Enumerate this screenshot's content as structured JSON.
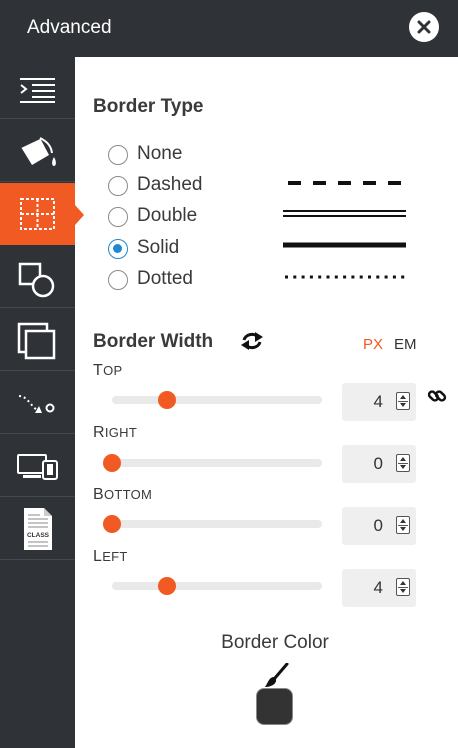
{
  "header": {
    "title": "Advanced"
  },
  "sidebar": {
    "items": [
      {
        "icon": "indent-icon"
      },
      {
        "icon": "paint-bucket-icon"
      },
      {
        "icon": "border-icon",
        "active": true
      },
      {
        "icon": "shapes-icon"
      },
      {
        "icon": "layers-icon"
      },
      {
        "icon": "motion-path-icon"
      },
      {
        "icon": "devices-icon"
      },
      {
        "icon": "class-file-icon",
        "label": "CLASS"
      }
    ]
  },
  "border_type": {
    "title": "Border Type",
    "options": [
      {
        "label": "None",
        "checked": false
      },
      {
        "label": "Dashed",
        "checked": false
      },
      {
        "label": "Double",
        "checked": false
      },
      {
        "label": "Solid",
        "checked": true
      },
      {
        "label": "Dotted",
        "checked": false
      }
    ]
  },
  "border_width": {
    "title": "Border Width",
    "units": [
      "PX",
      "EM"
    ],
    "active_unit": "PX",
    "sides": [
      {
        "label_first": "T",
        "label_rest": "OP",
        "value": "4",
        "fraction": 0.26
      },
      {
        "label_first": "R",
        "label_rest": "IGHT",
        "value": "0",
        "fraction": 0.0
      },
      {
        "label_first": "B",
        "label_rest": "OTTOM",
        "value": "0",
        "fraction": 0.0
      },
      {
        "label_first": "L",
        "label_rest": "EFT",
        "value": "4",
        "fraction": 0.26
      }
    ]
  },
  "border_color": {
    "label": "Border Color",
    "value": "#333333"
  },
  "colors": {
    "accent": "#f15a22",
    "sidebar": "#2f3236",
    "radio_checked": "#1e88d2"
  }
}
